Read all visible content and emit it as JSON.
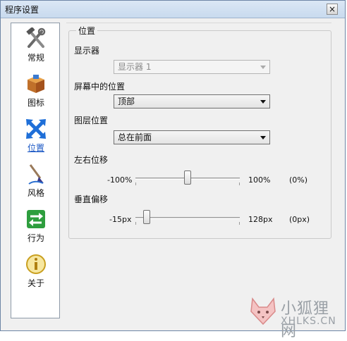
{
  "window": {
    "title": "程序设置",
    "close_glyph": "×"
  },
  "sidebar": {
    "items": [
      {
        "label": "常规",
        "icon": "tools-icon"
      },
      {
        "label": "图标",
        "icon": "box-icon"
      },
      {
        "label": "位置",
        "icon": "move-icon",
        "active": true
      },
      {
        "label": "风格",
        "icon": "brush-icon"
      },
      {
        "label": "行为",
        "icon": "arrows-icon"
      },
      {
        "label": "关于",
        "icon": "info-icon"
      }
    ]
  },
  "position_group": {
    "legend": "位置",
    "display": {
      "label": "显示器",
      "value": "显示器 1",
      "disabled": true
    },
    "screen_position": {
      "label": "屏幕中的位置",
      "value": "顶部"
    },
    "layer_position": {
      "label": "图层位置",
      "value": "总在前面"
    },
    "horizontal_offset": {
      "label": "左右位移",
      "min": "-100%",
      "max": "100%",
      "value_text": "(0%)",
      "value": 0,
      "range": [
        -100,
        100
      ]
    },
    "vertical_offset": {
      "label": "垂直偏移",
      "min": "-15px",
      "max": "128px",
      "value_text": "(0px)",
      "value": 0,
      "range": [
        -15,
        128
      ]
    }
  },
  "watermark": {
    "line1": "小狐狸网",
    "line2": "XHLKS.CN"
  },
  "colors": {
    "accent": "#1a57c4",
    "titlebar": "#c8daee"
  }
}
